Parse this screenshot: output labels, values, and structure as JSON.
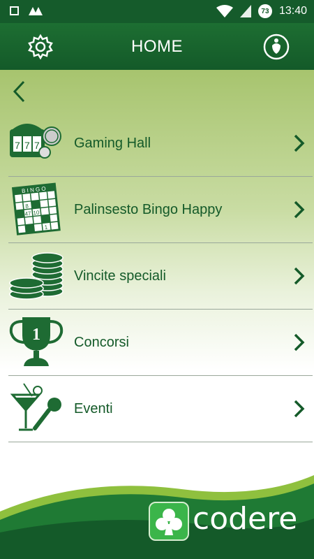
{
  "status": {
    "time": "13:40",
    "notification_count": "73"
  },
  "appbar": {
    "title": "HOME"
  },
  "menu": [
    {
      "label": "Gaming Hall",
      "icon": "slot-machine-icon"
    },
    {
      "label": "Palinsesto Bingo Happy",
      "icon": "bingo-card-icon"
    },
    {
      "label": "Vincite speciali",
      "icon": "coins-icon"
    },
    {
      "label": "Concorsi",
      "icon": "trophy-icon"
    },
    {
      "label": "Eventi",
      "icon": "cocktail-microphone-icon"
    }
  ],
  "bingo_card": {
    "header": "B I N G O",
    "numbers": [
      "8",
      "47",
      "10",
      "1"
    ]
  },
  "trophy": {
    "number": "1"
  },
  "brand": {
    "name": "codere",
    "colors": {
      "primary": "#155b2b",
      "accent": "#3bb54a"
    }
  }
}
